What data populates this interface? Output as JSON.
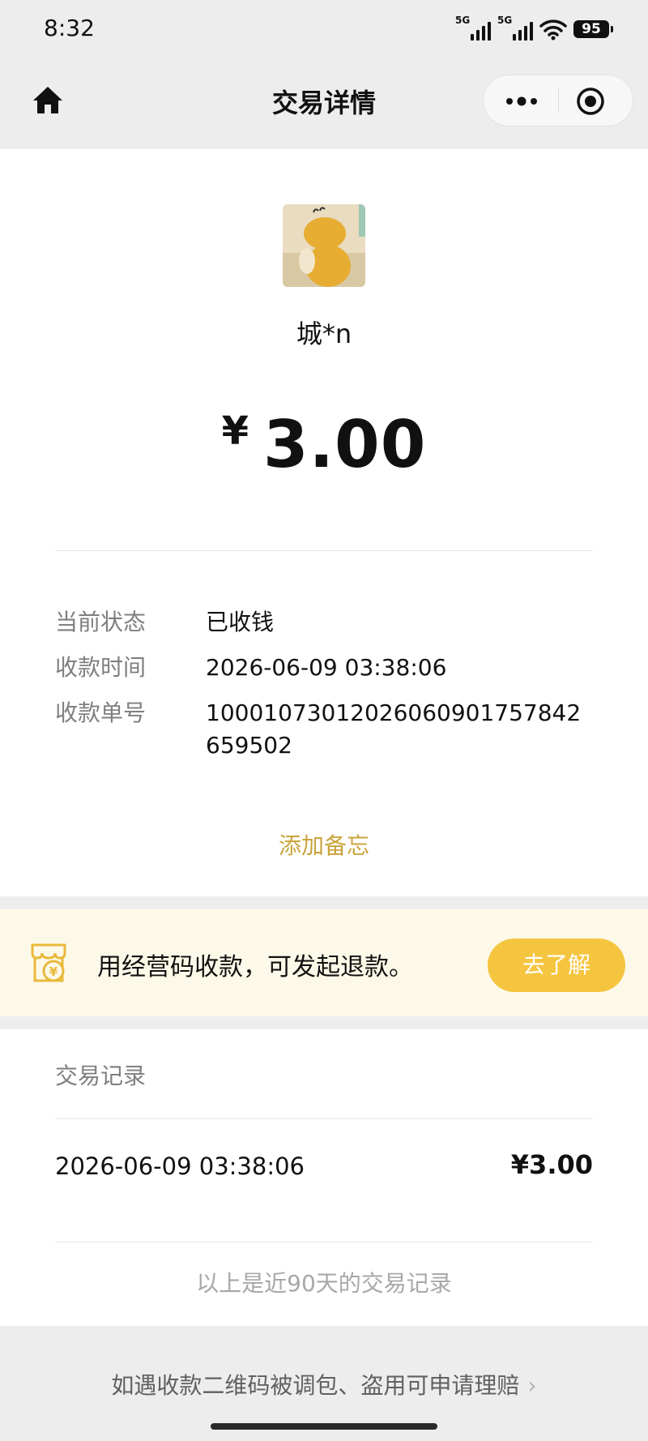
{
  "status_bar": {
    "time": "8:32",
    "signal_1_label": "5G",
    "signal_2_label": "5G",
    "wifi_icon": "wifi-icon",
    "battery": "95"
  },
  "nav": {
    "title": "交易详情",
    "home_icon": "home-icon",
    "more_icon": "more-dots-icon",
    "close_icon": "target-close-icon"
  },
  "transaction": {
    "payer_name": "城*n",
    "currency_symbol": "¥",
    "amount": "3.00",
    "rows": [
      {
        "label": "当前状态",
        "value": "已收钱"
      },
      {
        "label": "收款时间",
        "value": "2026-06-09 03:38:06"
      },
      {
        "label": "收款单号",
        "value": "100010730120260609017578426595​02"
      }
    ],
    "add_note": "添加备忘"
  },
  "promo": {
    "icon": "shop-yen-icon",
    "text": "用经营码收款，可发起退款。",
    "button": "去了解"
  },
  "records": {
    "title": "交易记录",
    "items": [
      {
        "time": "2026-06-09 03:38:06",
        "amount": "¥3.00"
      }
    ],
    "footer": "以上是近90天的交易记录"
  },
  "claim": {
    "text": "如遇收款二维码被调包、盗用可申请理赔",
    "chevron": "›"
  },
  "colors": {
    "accent_gold": "#c9a43c",
    "button_yellow": "#f5c53f",
    "promo_bg": "#fdf9e9",
    "page_bg": "#ededed"
  }
}
